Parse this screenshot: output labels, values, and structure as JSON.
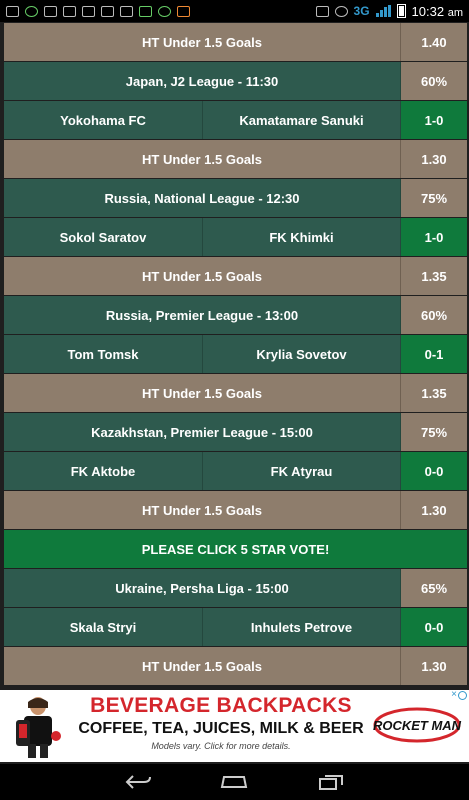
{
  "status_bar": {
    "network": "3G",
    "time": "10:32",
    "ampm": "am",
    "left_icons": [
      "sms-icon",
      "whatsapp-icon",
      "gallery-icon",
      "messenger-icon",
      "keyboard-icon",
      "alert-icon",
      "download-icon",
      "sd-card-icon",
      "app-icon",
      "game-icon"
    ],
    "right_icons": [
      "phone-icon",
      "alarm-icon",
      "signal-icon",
      "battery-icon"
    ]
  },
  "rows": [
    {
      "type": "tip",
      "label": "HT Under 1.5 Goals",
      "odd": "1.40"
    },
    {
      "type": "league",
      "label": "Japan, J2 League - 11:30",
      "pct": "60%"
    },
    {
      "type": "match",
      "home": "Yokohama FC",
      "away": "Kamatamare Sanuki",
      "score": "1-0"
    },
    {
      "type": "tip",
      "label": "HT Under 1.5 Goals",
      "odd": "1.30"
    },
    {
      "type": "league",
      "label": "Russia, National League - 12:30",
      "pct": "75%"
    },
    {
      "type": "match",
      "home": "Sokol Saratov",
      "away": "FK Khimki",
      "score": "1-0"
    },
    {
      "type": "tip",
      "label": "HT Under 1.5 Goals",
      "odd": "1.35"
    },
    {
      "type": "league",
      "label": "Russia, Premier League - 13:00",
      "pct": "60%"
    },
    {
      "type": "match",
      "home": "Tom Tomsk",
      "away": "Krylia Sovetov",
      "score": "0-1"
    },
    {
      "type": "tip",
      "label": "HT Under 1.5 Goals",
      "odd": "1.35"
    },
    {
      "type": "league",
      "label": "Kazakhstan, Premier League - 15:00",
      "pct": "75%"
    },
    {
      "type": "match",
      "home": "FK Aktobe",
      "away": "FK Atyrau",
      "score": "0-0"
    },
    {
      "type": "tip",
      "label": "HT Under 1.5 Goals",
      "odd": "1.30"
    },
    {
      "type": "promo",
      "label": "PLEASE CLICK 5 STAR VOTE!"
    },
    {
      "type": "league",
      "label": "Ukraine, Persha Liga - 15:00",
      "pct": "65%"
    },
    {
      "type": "match",
      "home": "Skala Stryi",
      "away": "Inhulets Petrove",
      "score": "0-0"
    },
    {
      "type": "tip",
      "label": "HT Under 1.5 Goals",
      "odd": "1.30"
    }
  ],
  "ad": {
    "title": "BEVERAGE BACKPACKS",
    "subtitle": "COFFEE, TEA, JUICES, MILK & BEER",
    "note": "Models vary. Click for more details.",
    "brand": "ROCKET MAN",
    "close": "×"
  },
  "nav": [
    "back-icon",
    "home-icon",
    "recent-apps-icon"
  ],
  "colors": {
    "tip_bg": "#8e7d6c",
    "league_bg": "#2e5a4e",
    "score_bg": "#0f7a3c",
    "ad_red": "#d4262c"
  }
}
